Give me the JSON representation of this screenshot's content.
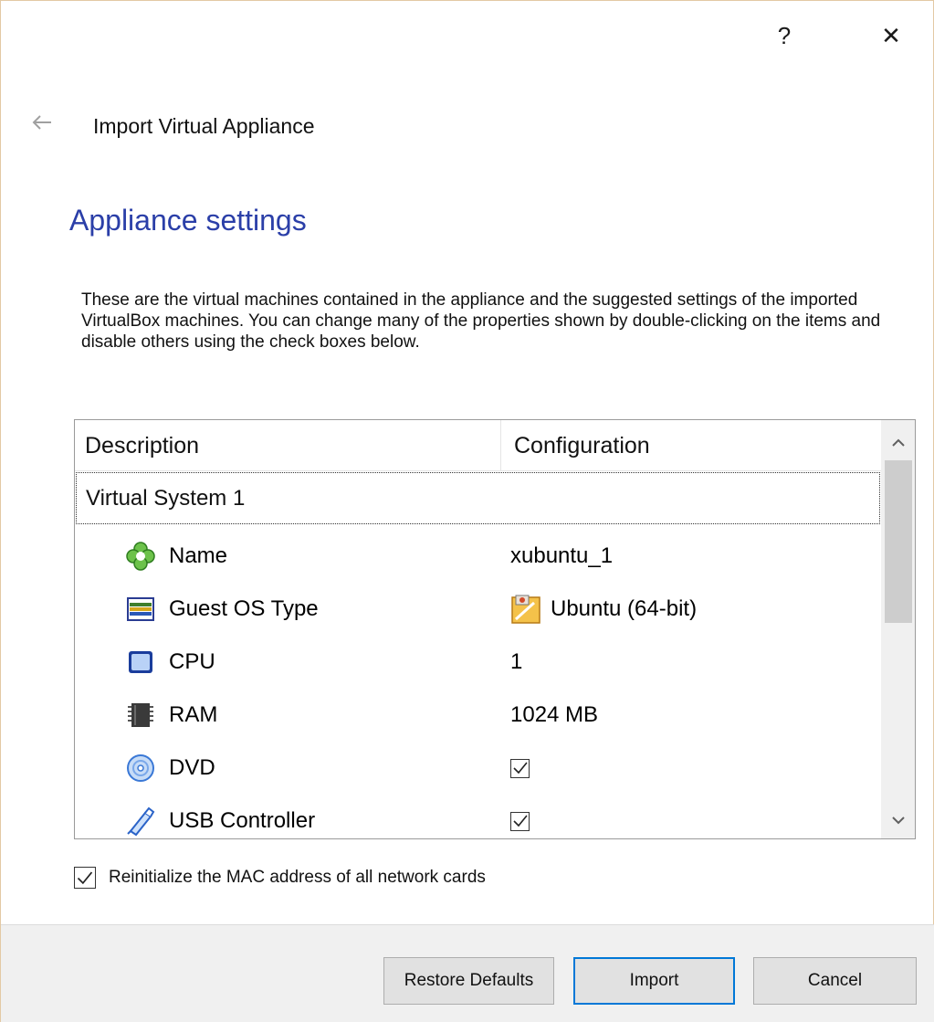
{
  "titlebar": {
    "help_label": "?",
    "close_label": "✕"
  },
  "wizard": {
    "title": "Import Virtual Appliance",
    "heading": "Appliance settings",
    "description": "These are the virtual machines contained in the appliance and the suggested settings of the imported VirtualBox machines. You can change many of the properties shown by double-clicking on the items and disable others using the check boxes below."
  },
  "tree": {
    "columns": [
      "Description",
      "Configuration"
    ],
    "group": "Virtual System 1",
    "rows": [
      {
        "label": "Name",
        "icon": "name-clover-icon",
        "value": "xubuntu_1",
        "value_type": "text"
      },
      {
        "label": "Guest OS Type",
        "icon": "os-type-icon",
        "value": "Ubuntu (64-bit)",
        "value_type": "os"
      },
      {
        "label": "CPU",
        "icon": "cpu-icon",
        "value": "1",
        "value_type": "text"
      },
      {
        "label": "RAM",
        "icon": "ram-icon",
        "value": "1024 MB",
        "value_type": "text"
      },
      {
        "label": "DVD",
        "icon": "dvd-icon",
        "value": "checked",
        "value_type": "checkbox"
      },
      {
        "label": "USB Controller",
        "icon": "usb-icon",
        "value": "checked",
        "value_type": "checkbox"
      }
    ]
  },
  "mac_option": {
    "label": "Reinitialize the MAC address of all network cards",
    "checked": true
  },
  "buttons": {
    "restore": "Restore Defaults",
    "import": "Import",
    "cancel": "Cancel"
  },
  "colors": {
    "heading": "#2b3fa8",
    "accent_border": "#0078d7",
    "footer_bg": "#f0f0f0"
  }
}
